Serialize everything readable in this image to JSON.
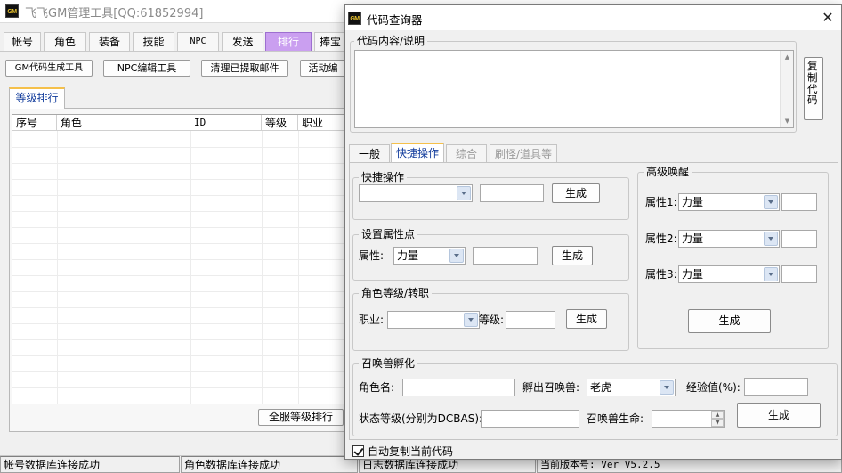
{
  "main_window": {
    "title": "飞飞GM管理工具[QQ:61852994]",
    "logo": "GM",
    "tabs": [
      {
        "label": "帐号"
      },
      {
        "label": "角色"
      },
      {
        "label": "装备"
      },
      {
        "label": "技能"
      },
      {
        "label": "NPC"
      },
      {
        "label": "发送"
      },
      {
        "label": "排行"
      },
      {
        "label": "捧宝"
      }
    ],
    "active_tab": "排行",
    "toolbar_buttons": [
      "GM代码生成工具",
      "NPC编辑工具",
      "清理已提取邮件",
      "活动编"
    ],
    "sub_tab": "等级排行",
    "table_columns": [
      "序号",
      "角色",
      "ID",
      "等级",
      "职业"
    ],
    "all_rank_button": "全服等级排行"
  },
  "status_bar": [
    "帐号数据库连接成功",
    "角色数据库连接成功",
    "日志数据库连接成功",
    "当前版本号: Ver V5.2.5"
  ],
  "dialog": {
    "title": "代码查询器",
    "logo": "GM",
    "code_group_label": "代码内容/说明",
    "copy_button": "复制代码",
    "tabs": [
      {
        "label": "一般"
      },
      {
        "label": "快捷操作"
      },
      {
        "label": "综合"
      },
      {
        "label": "刷怪/道具等"
      }
    ],
    "active_tab": "快捷操作",
    "quick_op": {
      "legend": "快捷操作",
      "combo_value": "",
      "input_value": "",
      "generate": "生成"
    },
    "set_attr": {
      "legend": "设置属性点",
      "attr_label": "属性:",
      "attr_value": "力量",
      "input_value": "",
      "generate": "生成"
    },
    "role_level": {
      "legend": "角色等级/转职",
      "job_label": "职业:",
      "job_value": "",
      "level_label": "等级:",
      "level_value": "",
      "generate": "生成"
    },
    "awakening": {
      "legend": "高级唤醒",
      "attrs": [
        {
          "label": "属性1:",
          "value": "力量",
          "input": ""
        },
        {
          "label": "属性2:",
          "value": "力量",
          "input": ""
        },
        {
          "label": "属性3:",
          "value": "力量",
          "input": ""
        }
      ],
      "generate": "生成"
    },
    "summon": {
      "legend": "召唤兽孵化",
      "role_name_label": "角色名:",
      "role_name_value": "",
      "hatch_label": "孵出召唤兽:",
      "hatch_value": "老虎",
      "exp_label": "经验值(%):",
      "exp_value": "",
      "state_level_label": "状态等级(分别为DCBAS):",
      "state_level_value": "",
      "hp_label": "召唤兽生命:",
      "hp_value": "",
      "generate": "生成"
    },
    "auto_copy_checkbox": {
      "label": "自动复制当前代码",
      "checked": true
    }
  },
  "colors": {
    "active_main_tab": "#ca9ff0",
    "tab_highlight": "#f5c04a",
    "active_tab_text": "#123c9c"
  }
}
